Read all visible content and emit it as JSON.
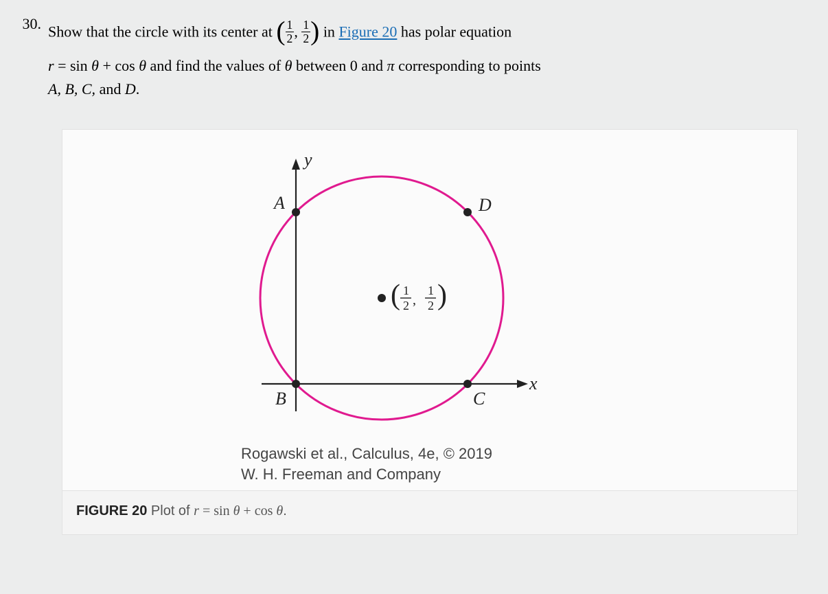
{
  "problem": {
    "number": "30.",
    "sentence1_a": "Show that the circle with its center at ",
    "frac1_num": "1",
    "frac1_den": "2",
    "comma": ", ",
    "frac2_num": "1",
    "frac2_den": "2",
    "sentence1_b": " in ",
    "link_text": "Figure 20",
    "sentence1_c": " has polar equation",
    "r_var": "r",
    "eq": " = ",
    "sin": "sin ",
    "theta1": "θ",
    "plus": " + ",
    "cos": "cos ",
    "theta2": "θ",
    "sentence2_a": " and find the values of ",
    "theta3": "θ",
    "sentence2_b": " between 0 and ",
    "pi": "π",
    "sentence2_c": " corresponding to points",
    "points_list": "A, B, C, ",
    "and": " and ",
    "point_d": "D",
    "period": "."
  },
  "figure": {
    "y_label": "y",
    "x_label": "x",
    "A": "A",
    "B": "B",
    "C": "C",
    "D": "D",
    "center_label_open": "(",
    "center_num1": "1",
    "center_den1": "2",
    "center_comma": ", ",
    "center_num2": "1",
    "center_den2": "2",
    "center_label_close": ")",
    "attr1": "Rogawski et al., Calculus, 4e, © 2019",
    "attr2": "W. H. Freeman and Company"
  },
  "footer": {
    "fig_label": "FIGURE 20",
    "plot_of": " Plot of ",
    "r": "r",
    "eq": " = ",
    "sin": "sin ",
    "theta1": "θ",
    "plus": " + ",
    "cos": "cos ",
    "theta2": "θ",
    "period": "."
  }
}
